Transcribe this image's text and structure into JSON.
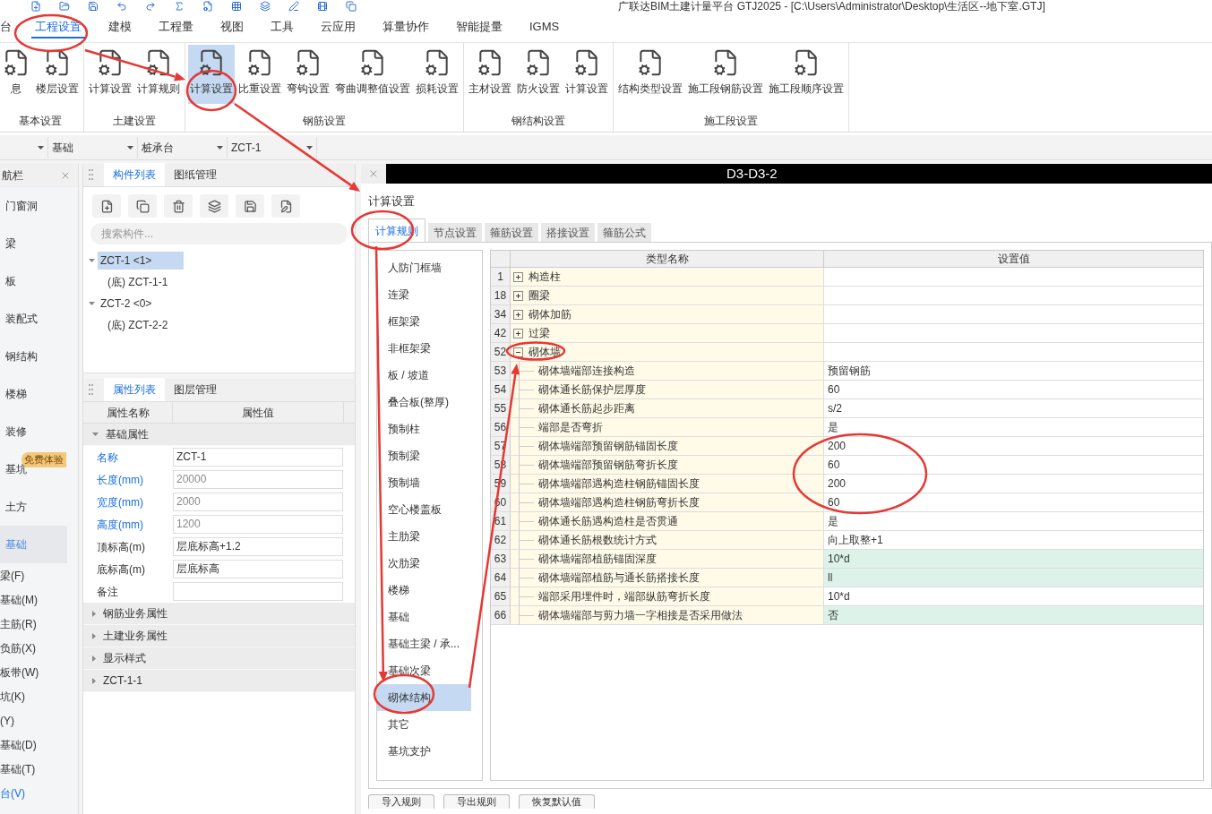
{
  "window": {
    "title": "广联达BIM土建计量平台 GTJ2025 - [C:\\Users\\Administrator\\Desktop\\生活区--地下室.GTJ]"
  },
  "menu": [
    {
      "label": "台",
      "selected": false
    },
    {
      "label": "工程设置",
      "selected": true
    },
    {
      "label": "建模",
      "selected": false
    },
    {
      "label": "工程量",
      "selected": false
    },
    {
      "label": "视图",
      "selected": false
    },
    {
      "label": "工具",
      "selected": false
    },
    {
      "label": "云应用",
      "selected": false
    },
    {
      "label": "算量协作",
      "selected": false
    },
    {
      "label": "智能提量",
      "selected": false
    },
    {
      "label": "IGMS",
      "selected": false
    }
  ],
  "ribbon": [
    {
      "name": "基本设置",
      "buttons": [
        {
          "label": "息",
          "selected": false
        },
        {
          "label": "楼层设置",
          "selected": false
        }
      ]
    },
    {
      "name": "土建设置",
      "buttons": [
        {
          "label": "计算设置",
          "selected": false
        },
        {
          "label": "计算规则",
          "selected": false
        }
      ]
    },
    {
      "name": "钢筋设置",
      "buttons": [
        {
          "label": "计算设置",
          "selected": true
        },
        {
          "label": "比重设置",
          "selected": false
        },
        {
          "label": "弯钩设置",
          "selected": false
        },
        {
          "label": "弯曲调整值设置",
          "selected": false
        },
        {
          "label": "损耗设置",
          "selected": false
        }
      ]
    },
    {
      "name": "钢结构设置",
      "buttons": [
        {
          "label": "主材设置",
          "selected": false
        },
        {
          "label": "防火设置",
          "selected": false
        },
        {
          "label": "计算设置",
          "selected": false
        }
      ]
    },
    {
      "name": "施工段设置",
      "buttons": [
        {
          "label": "结构类型设置",
          "selected": false
        },
        {
          "label": "施工段钢筋设置",
          "selected": false
        },
        {
          "label": "施工段顺序设置",
          "selected": false
        }
      ]
    }
  ],
  "selectors": [
    "基础",
    "桩承台",
    "ZCT-1"
  ],
  "nav": {
    "title": "航栏",
    "items": [
      {
        "label": "门窗洞",
        "selected": false
      },
      {
        "label": "梁",
        "selected": false
      },
      {
        "label": "板",
        "selected": false
      },
      {
        "label": "装配式",
        "selected": false
      },
      {
        "label": "钢结构",
        "selected": false
      },
      {
        "label": "楼梯",
        "selected": false
      },
      {
        "label": "装修",
        "selected": false
      },
      {
        "label": "基坑",
        "selected": false,
        "badge": "免费体验"
      },
      {
        "label": "土方",
        "selected": false
      },
      {
        "label": "基础",
        "selected": true
      }
    ],
    "sub_items": [
      {
        "label": "梁(F)",
        "selected": false
      },
      {
        "label": "基础(M)",
        "selected": false
      },
      {
        "label": "主筋(R)",
        "selected": false
      },
      {
        "label": "负筋(X)",
        "selected": false
      },
      {
        "label": "板带(W)",
        "selected": false
      },
      {
        "label": "坑(K)",
        "selected": false
      },
      {
        "label": "(Y)",
        "selected": false
      },
      {
        "label": "基础(D)",
        "selected": false
      },
      {
        "label": "基础(T)",
        "selected": false
      },
      {
        "label": "台(V)",
        "selected": true
      }
    ]
  },
  "component_panel": {
    "tabs": [
      {
        "label": "构件列表",
        "selected": true
      },
      {
        "label": "图纸管理",
        "selected": false
      }
    ],
    "search": {
      "placeholder": "搜索构件..."
    },
    "tree": [
      {
        "label": "ZCT-1 <1>",
        "selected": true,
        "expanded": true,
        "children": [
          {
            "label": "(底) ZCT-1-1",
            "selected": false
          }
        ]
      },
      {
        "label": "ZCT-2 <0>",
        "selected": false,
        "expanded": true,
        "children": [
          {
            "label": "(底) ZCT-2-2",
            "selected": false
          }
        ]
      }
    ]
  },
  "property_panel": {
    "tabs": [
      {
        "label": "属性列表",
        "selected": true
      },
      {
        "label": "图层管理",
        "selected": false
      }
    ],
    "columns": [
      "属性名称",
      "属性值"
    ],
    "groups": [
      {
        "label": "基础属性",
        "expanded": true,
        "rows": [
          {
            "name": "名称",
            "value": "ZCT-1",
            "public": true,
            "disabled": false
          },
          {
            "name": "长度(mm)",
            "value": "20000",
            "public": true,
            "disabled": true
          },
          {
            "name": "宽度(mm)",
            "value": "2000",
            "public": true,
            "disabled": true
          },
          {
            "name": "高度(mm)",
            "value": "1200",
            "public": true,
            "disabled": true
          },
          {
            "name": "顶标高(m)",
            "value": "层底标高+1.2",
            "public": false,
            "disabled": false
          },
          {
            "name": "底标高(m)",
            "value": "层底标高",
            "public": false,
            "disabled": false
          },
          {
            "name": "备注",
            "public": false,
            "disabled": false
          }
        ]
      },
      {
        "label": "钢筋业务属性",
        "expanded": false
      },
      {
        "label": "土建业务属性",
        "expanded": false
      },
      {
        "label": "显示样式",
        "expanded": false
      },
      {
        "label": "ZCT-1-1",
        "expanded": false
      }
    ]
  },
  "canvas": {
    "label": "D3-D3-2"
  },
  "dialog": {
    "title": "计算设置",
    "tabs": [
      {
        "label": "计算规则",
        "selected": true
      },
      {
        "label": "节点设置",
        "selected": false
      },
      {
        "label": "箍筋设置",
        "selected": false
      },
      {
        "label": "搭接设置",
        "selected": false
      },
      {
        "label": "箍筋公式",
        "selected": false
      }
    ],
    "categories": [
      {
        "label": "人防门框墙",
        "selected": false
      },
      {
        "label": "连梁",
        "selected": false
      },
      {
        "label": "框架梁",
        "selected": false
      },
      {
        "label": "非框架梁",
        "selected": false
      },
      {
        "label": "板 / 坡道",
        "selected": false
      },
      {
        "label": "叠合板(整厚)",
        "selected": false
      },
      {
        "label": "预制柱",
        "selected": false
      },
      {
        "label": "预制梁",
        "selected": false
      },
      {
        "label": "预制墙",
        "selected": false
      },
      {
        "label": "空心楼盖板",
        "selected": false
      },
      {
        "label": "主肋梁",
        "selected": false
      },
      {
        "label": "次肋梁",
        "selected": false
      },
      {
        "label": "楼梯",
        "selected": false
      },
      {
        "label": "基础",
        "selected": false
      },
      {
        "label": "基础主梁 / 承...",
        "selected": false
      },
      {
        "label": "基础次梁",
        "selected": false
      },
      {
        "label": "砌体结构",
        "selected": true
      },
      {
        "label": "其它",
        "selected": false
      },
      {
        "label": "基坑支护",
        "selected": false
      }
    ],
    "columns": [
      "类型名称",
      "设置值"
    ],
    "rows": [
      {
        "no": "1",
        "kind": "group",
        "expanded": false,
        "name": "构造柱"
      },
      {
        "no": "18",
        "kind": "group",
        "expanded": false,
        "name": "圈梁"
      },
      {
        "no": "34",
        "kind": "group",
        "expanded": false,
        "name": "砌体加筋"
      },
      {
        "no": "42",
        "kind": "group",
        "expanded": false,
        "name": "过梁"
      },
      {
        "no": "52",
        "kind": "group",
        "expanded": true,
        "name": "砌体墙"
      },
      {
        "no": "53",
        "kind": "item",
        "name": "砌体墙端部连接构造",
        "value": "预留钢筋",
        "changed": false
      },
      {
        "no": "54",
        "kind": "item",
        "name": "砌体通长筋保护层厚度",
        "value": "60",
        "changed": false
      },
      {
        "no": "55",
        "kind": "item",
        "name": "砌体通长筋起步距离",
        "value": "s/2",
        "changed": false
      },
      {
        "no": "56",
        "kind": "item",
        "name": "端部是否弯折",
        "value": "是",
        "changed": false
      },
      {
        "no": "57",
        "kind": "item",
        "name": "砌体墙端部预留钢筋锚固长度",
        "value": "200",
        "changed": false
      },
      {
        "no": "58",
        "kind": "item",
        "name": "砌体墙端部预留钢筋弯折长度",
        "value": "60",
        "changed": false
      },
      {
        "no": "59",
        "kind": "item",
        "name": "砌体墙端部遇构造柱钢筋锚固长度",
        "value": "200",
        "changed": false
      },
      {
        "no": "60",
        "kind": "item",
        "name": "砌体墙端部遇构造柱钢筋弯折长度",
        "value": "60",
        "changed": false
      },
      {
        "no": "61",
        "kind": "item",
        "name": "砌体通长筋遇构造柱是否贯通",
        "value": "是",
        "changed": false
      },
      {
        "no": "62",
        "kind": "item",
        "name": "砌体通长筋根数统计方式",
        "value": "向上取整+1",
        "changed": false
      },
      {
        "no": "63",
        "kind": "item",
        "name": "砌体墙端部植筋锚固深度",
        "value": "10*d",
        "changed": true
      },
      {
        "no": "64",
        "kind": "item",
        "name": "砌体墙端部植筋与通长筋搭接长度",
        "value": "ll",
        "changed": true
      },
      {
        "no": "65",
        "kind": "item",
        "name": "端部采用埋件时，端部纵筋弯折长度",
        "value": "10*d",
        "changed": false
      },
      {
        "no": "66",
        "kind": "item",
        "name": "砌体墙端部与剪力墙一字相接是否采用做法",
        "value": "否",
        "changed": true
      }
    ],
    "buttons": [
      "导入规则",
      "导出规则",
      "恢复默认值"
    ]
  }
}
